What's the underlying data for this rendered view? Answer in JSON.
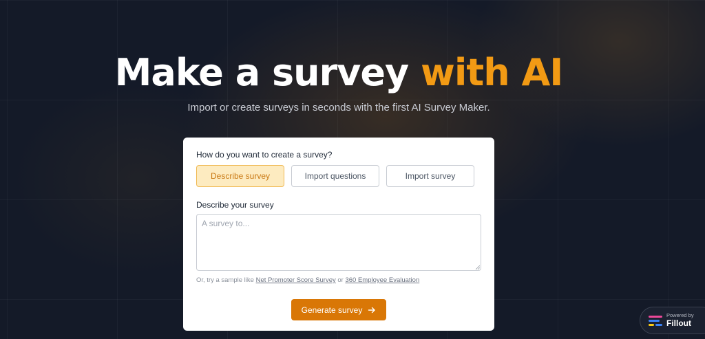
{
  "hero": {
    "title_main": "Make a survey ",
    "title_accent": "with AI",
    "subtitle": "Import or create surveys in seconds with the first AI Survey Maker."
  },
  "form": {
    "question_label": "How do you want to create a survey?",
    "options": [
      {
        "label": "Describe survey",
        "selected": true
      },
      {
        "label": "Import questions",
        "selected": false
      },
      {
        "label": "Import survey",
        "selected": false
      }
    ],
    "describe_label": "Describe your survey",
    "textarea": {
      "placeholder": "A survey to...",
      "value": ""
    },
    "samples": {
      "prefix": "Or, try a sample like ",
      "link1": "Net Promoter Score Survey",
      "middle": " or ",
      "link2": "360 Employee Evaluation"
    },
    "generate_label": "Generate survey",
    "generate_icon": "arrow-right-icon"
  },
  "badge": {
    "small": "Powered by",
    "brand": "Fillout"
  },
  "colors": {
    "background": "#141a28",
    "accent": "#f29a14",
    "button": "#d97706",
    "selected_bg": "#fdebc0",
    "selected_text": "#c97812",
    "logo_pink": "#ec4899",
    "logo_blue": "#3b82f6",
    "logo_yellow": "#facc15"
  }
}
